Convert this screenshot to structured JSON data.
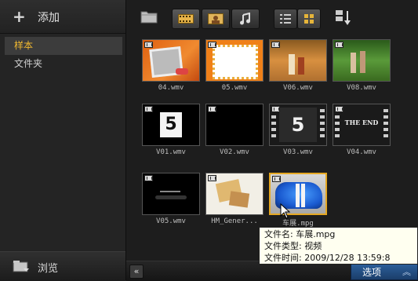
{
  "left_panel": {
    "add_label": "添加",
    "items": [
      {
        "label": "样本"
      },
      {
        "label": "文件夹"
      }
    ],
    "browse_label": "浏览"
  },
  "toolbar": {
    "buttons": [
      "folder-icon",
      "video-filter-icon",
      "photo-filter-icon",
      "audio-filter-icon",
      "list-view-icon",
      "thumbnail-view-icon",
      "sort-icon"
    ]
  },
  "thumbnails": [
    {
      "caption": "04.wmv"
    },
    {
      "caption": "05.wmv"
    },
    {
      "caption": "V06.wmv"
    },
    {
      "caption": "V08.wmv"
    },
    {
      "caption": "V01.wmv"
    },
    {
      "caption": "V02.wmv"
    },
    {
      "caption": "V03.wmv"
    },
    {
      "caption": "V04.wmv"
    },
    {
      "caption": "V05.wmv"
    },
    {
      "caption": "HM_Gener..."
    },
    {
      "caption": "车展.mpg"
    }
  ],
  "thumb_text": {
    "v01_digit": "5",
    "v03_digit": "5",
    "v04_text": "THE END"
  },
  "bottom": {
    "options_label": "选项"
  },
  "tooltip": {
    "line1": "文件名: 车展.mpg",
    "line2": "文件类型: 视频",
    "line3": "文件时间: 2009/12/28 13:59:8"
  },
  "colors": {
    "accent": "#e5a823",
    "selected_item_text": "#f0b830",
    "options_blue": "#2c5f9b"
  }
}
